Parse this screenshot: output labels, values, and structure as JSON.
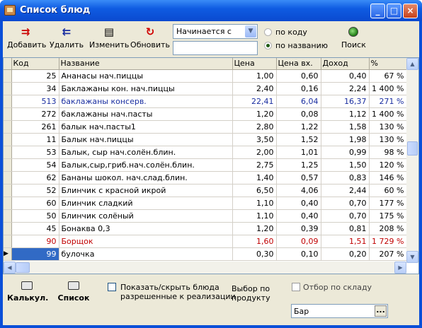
{
  "window": {
    "title": "Список блюд"
  },
  "toolbar": {
    "add_label": "Добавить",
    "delete_label": "Удалить",
    "edit_label": "Изменить",
    "refresh_label": "Обновить",
    "search_label": "Поиск",
    "filter_mode": "Начинается с",
    "search_text": "",
    "radio_code": "по коду",
    "radio_name": "по названию",
    "radio_selected": "по названию"
  },
  "table": {
    "columns": [
      "Код",
      "Название",
      "Цена",
      "Цена вх.",
      "Доход",
      "%"
    ],
    "rows": [
      {
        "code": "25",
        "name": "Ананасы нач.пиццы",
        "price": "1,00",
        "price_in": "0,60",
        "income": "0,40",
        "pct": "67 %",
        "style": ""
      },
      {
        "code": "34",
        "name": "Баклажаны кон. нач.пиццы",
        "price": "2,40",
        "price_in": "0,16",
        "income": "2,24",
        "pct": "1 400 %",
        "style": ""
      },
      {
        "code": "513",
        "name": "баклажаны консерв.",
        "price": "22,41",
        "price_in": "6,04",
        "income": "16,37",
        "pct": "271 %",
        "style": "blue"
      },
      {
        "code": "272",
        "name": "баклажаны нач.пасты",
        "price": "1,20",
        "price_in": "0,08",
        "income": "1,12",
        "pct": "1 400 %",
        "style": ""
      },
      {
        "code": "261",
        "name": "балык нач.пасты1",
        "price": "2,80",
        "price_in": "1,22",
        "income": "1,58",
        "pct": "130 %",
        "style": ""
      },
      {
        "code": "11",
        "name": "Балык нач.пиццы",
        "price": "3,50",
        "price_in": "1,52",
        "income": "1,98",
        "pct": "130 %",
        "style": ""
      },
      {
        "code": "53",
        "name": "Балык, сыр нач.солён.блин.",
        "price": "2,00",
        "price_in": "1,01",
        "income": "0,99",
        "pct": "98 %",
        "style": ""
      },
      {
        "code": "54",
        "name": "Балык,сыр,гриб.нач.солён.блин.",
        "price": "2,75",
        "price_in": "1,25",
        "income": "1,50",
        "pct": "120 %",
        "style": ""
      },
      {
        "code": "62",
        "name": "Бананы шокол. нач.слад.блин.",
        "price": "1,40",
        "price_in": "0,57",
        "income": "0,83",
        "pct": "146 %",
        "style": ""
      },
      {
        "code": "52",
        "name": "Блинчик с красной икрой",
        "price": "6,50",
        "price_in": "4,06",
        "income": "2,44",
        "pct": "60 %",
        "style": ""
      },
      {
        "code": "60",
        "name": "Блинчик сладкий",
        "price": "1,10",
        "price_in": "0,40",
        "income": "0,70",
        "pct": "177 %",
        "style": ""
      },
      {
        "code": "50",
        "name": "Блинчик солёный",
        "price": "1,10",
        "price_in": "0,40",
        "income": "0,70",
        "pct": "175 %",
        "style": ""
      },
      {
        "code": "45",
        "name": "Бонаква 0,3",
        "price": "1,20",
        "price_in": "0,39",
        "income": "0,81",
        "pct": "208 %",
        "style": ""
      },
      {
        "code": "90",
        "name": "Борщок",
        "price": "1,60",
        "price_in": "0,09",
        "income": "1,51",
        "pct": "1 729 %",
        "style": "red"
      },
      {
        "code": "99",
        "name": "булочка",
        "price": "0,30",
        "price_in": "0,10",
        "income": "0,20",
        "pct": "207 %",
        "style": "current"
      }
    ]
  },
  "bottom": {
    "calc_label": "Калькул.",
    "list_label": "Список",
    "show_hide_line1": "Показать/скрыть блюда",
    "show_hide_line2": "разрешенные к реализации",
    "product_select_line1": "Выбор по",
    "product_select_line2": "продукту",
    "warehouse_filter_label": "Отбор по складу",
    "warehouse_value": "Бар",
    "browse_label": "..."
  }
}
